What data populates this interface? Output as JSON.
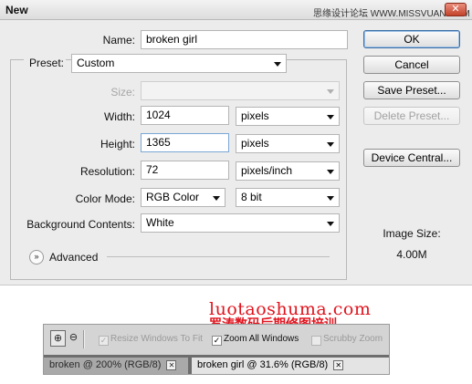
{
  "window": {
    "title": "New",
    "watermark": "思缘设计论坛 WWW.MISSVUAN.COM",
    "close_glyph": "✕"
  },
  "form": {
    "name": {
      "label": "Name:",
      "value": "broken girl"
    },
    "preset": {
      "label": "Preset:",
      "value": "Custom"
    },
    "size": {
      "label": "Size:",
      "value": ""
    },
    "width": {
      "label": "Width:",
      "value": "1024",
      "unit": "pixels"
    },
    "height": {
      "label": "Height:",
      "value": "1365",
      "unit": "pixels"
    },
    "resolution": {
      "label": "Resolution:",
      "value": "72",
      "unit": "pixels/inch"
    },
    "color_mode": {
      "label": "Color Mode:",
      "value": "RGB Color",
      "depth": "8 bit"
    },
    "background": {
      "label": "Background Contents:",
      "value": "White"
    },
    "advanced": {
      "label": "Advanced",
      "icon": "double-chevron-down-icon"
    }
  },
  "buttons": {
    "ok": "OK",
    "cancel": "Cancel",
    "save_preset": "Save Preset...",
    "delete_preset": "Delete Preset...",
    "device_central": "Device Central..."
  },
  "image_size": {
    "label": "Image Size:",
    "value": "4.00M"
  },
  "watermark": {
    "url": "luotaoshuma.com",
    "text": "罗涛数码后期修图培训"
  },
  "options_bar": {
    "zoom_in_icon": "zoom-in-icon",
    "zoom_out_icon": "zoom-out-icon",
    "resize_windows": "Resize Windows To Fit",
    "zoom_all_windows": "Zoom All Windows",
    "scrubby_zoom": "Scrubby Zoom",
    "check_glyph": "✓"
  },
  "tabs": [
    {
      "label": "broken @ 200% (RGB/8)",
      "close": "✕"
    },
    {
      "label": "broken girl @ 31.6% (RGB/8)",
      "close": "✕"
    }
  ]
}
